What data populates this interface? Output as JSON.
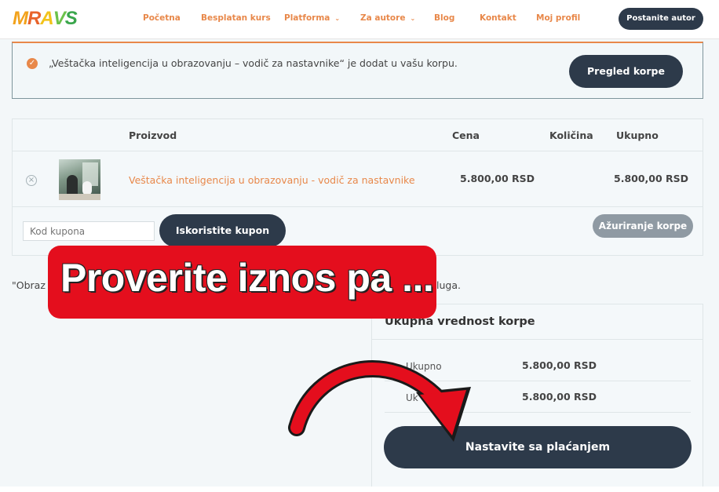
{
  "header": {
    "logo": [
      "M",
      "R",
      "A",
      "V",
      "S"
    ],
    "nav": [
      {
        "label": "Početna"
      },
      {
        "label": "Besplatan kurs"
      },
      {
        "label": "Platforma",
        "dropdown": true
      },
      {
        "label": "Za autore",
        "dropdown": true
      },
      {
        "label": "Blog"
      },
      {
        "label": "Kontakt"
      },
      {
        "label": "Moj profil"
      }
    ],
    "cta": "Postanite autor"
  },
  "notice": {
    "text": "„Veštačka inteligencija u obrazovanju – vodič za nastavnike“ je dodat u vašu korpu.",
    "button": "Pregled korpe"
  },
  "cart": {
    "columns": {
      "product": "Proizvod",
      "price": "Cena",
      "qty": "Količina",
      "subtotal": "Ukupno"
    },
    "item": {
      "name": "Veštačka inteligencija u obrazovanju - vodič za nastavnike",
      "price": "5.800,00 RSD",
      "subtotal": "5.800,00 RSD"
    },
    "coupon_placeholder": "Kod kupona",
    "coupon_button": "Iskoristite kupon",
    "update_button": "Ažuriranje korpe"
  },
  "note": {
    "left": "\"Obraz",
    "right": "luga."
  },
  "totals": {
    "title": "Ukupna vrednost korpe",
    "rows": [
      {
        "label": "Ukupno",
        "value": "5.800,00 RSD"
      },
      {
        "label": "Uk",
        "value": "5.800,00 RSD"
      }
    ],
    "checkout": "Nastavite sa plaćanjem"
  },
  "overlay": {
    "callout": "Proverite iznos pa ..."
  },
  "colors": {
    "accent": "#e8884a",
    "dark_button": "#2d3a4a",
    "callout_red": "#e40e1d"
  },
  "icons": [
    "check-circle-icon",
    "remove-icon",
    "chevron-down-icon",
    "curved-arrow-icon"
  ]
}
